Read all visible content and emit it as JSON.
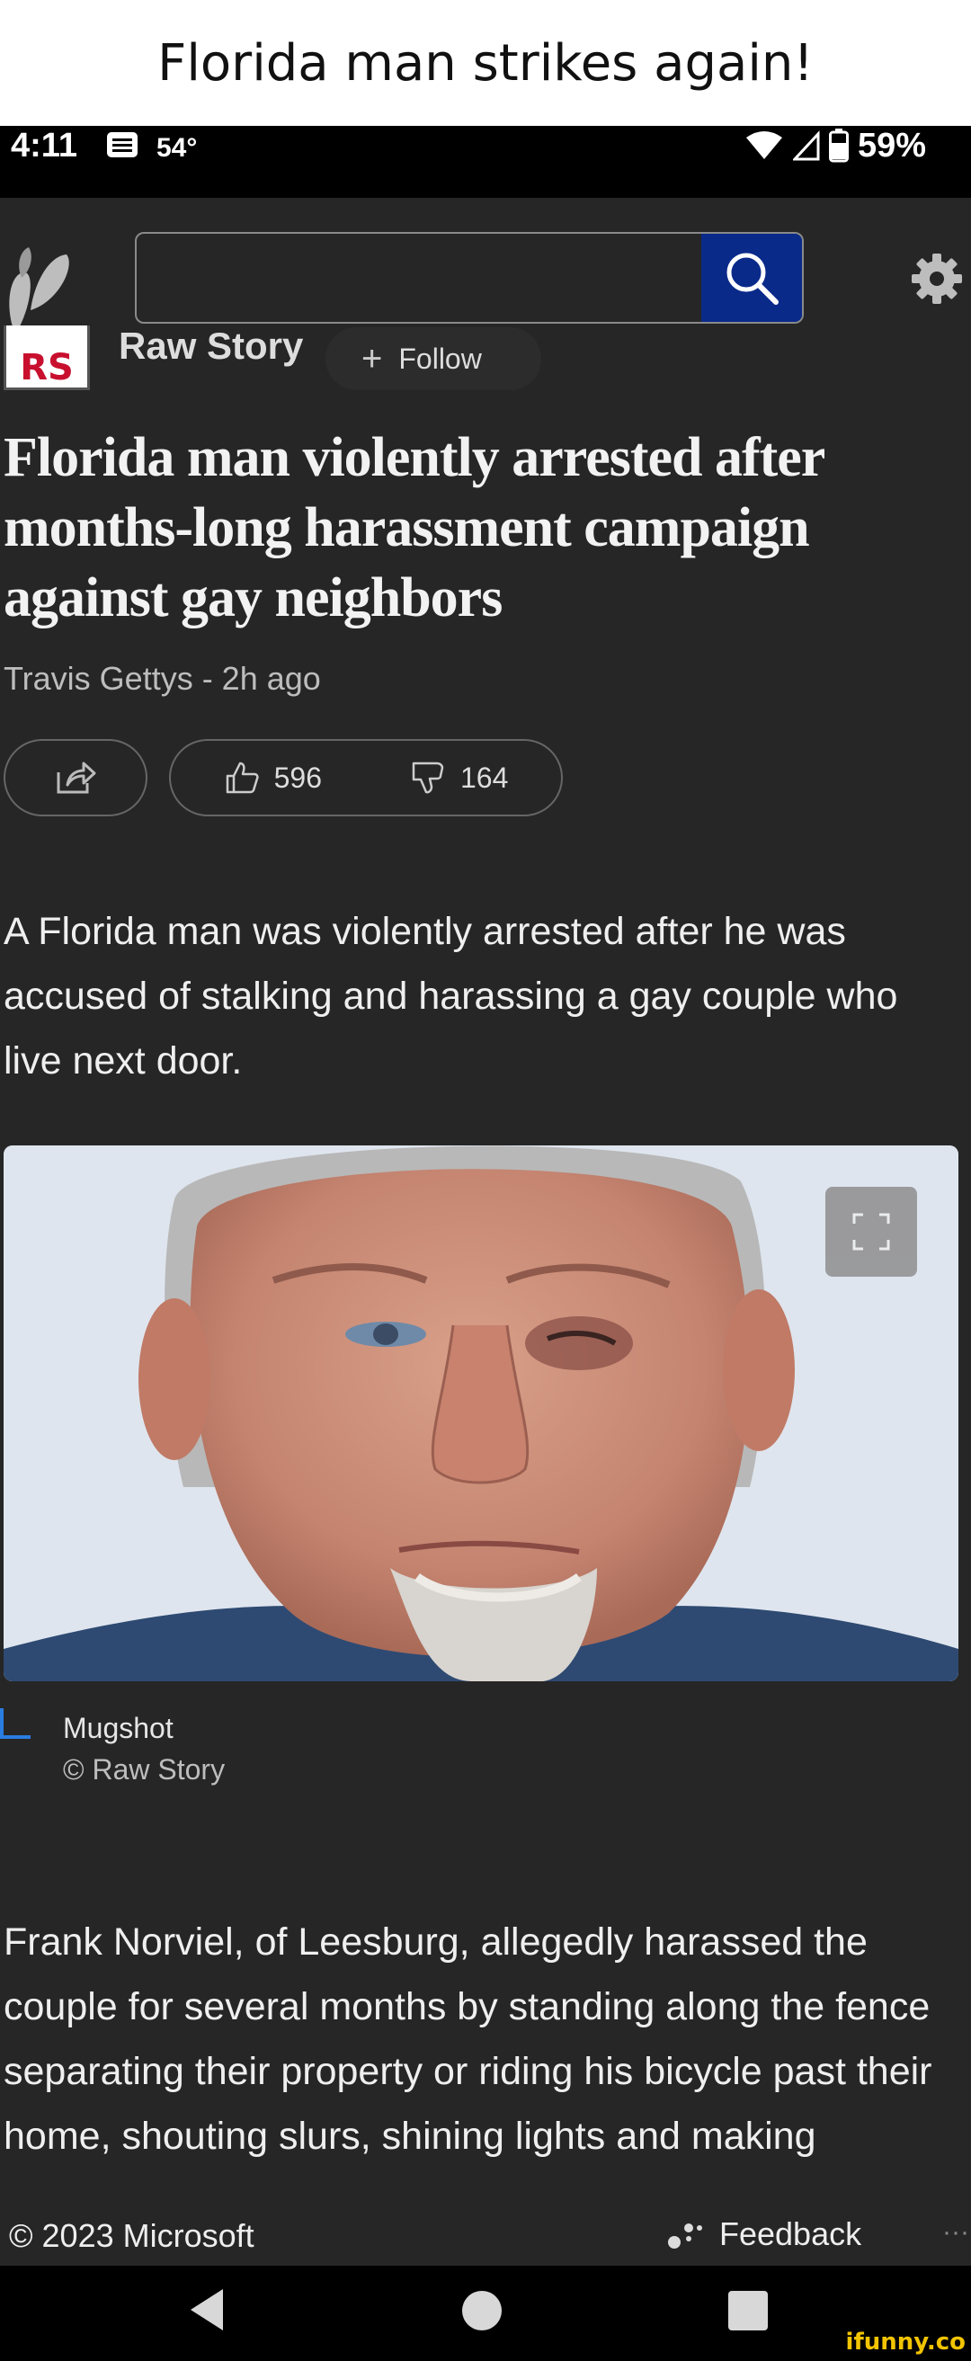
{
  "meme_caption": "Florida man strikes again!",
  "status_bar": {
    "time": "4:11",
    "temperature": "54°",
    "battery": "59%"
  },
  "search": {
    "placeholder": ""
  },
  "source": {
    "name": "Raw Story",
    "logo_text": "RS",
    "follow_label": "Follow"
  },
  "article": {
    "headline": "Florida man violently arrested after months-long harassment campaign against gay neighbors",
    "byline": "Travis Gettys - 2h ago",
    "likes": "596",
    "dislikes": "164",
    "paragraph1": "A Florida man was violently arrested after he was accused of stalking and harassing a gay couple who live next door.",
    "image_caption": "Mugshot",
    "image_credit": "© Raw Story",
    "paragraph2": "Frank Norviel, of Leesburg, allegedly harassed the couple for several months by standing along the fence separating their property or riding his bicycle past their home, shouting slurs, shining lights and making homophobic remarks, reported"
  },
  "footer": {
    "copyright": "© 2023 Microsoft",
    "feedback": "Feedback",
    "more": "···"
  },
  "watermark": "ifunny.co",
  "colors": {
    "search_button": "#0a2a8a",
    "caption_accent": "#2a7de1",
    "watermark": "#f2c400"
  }
}
